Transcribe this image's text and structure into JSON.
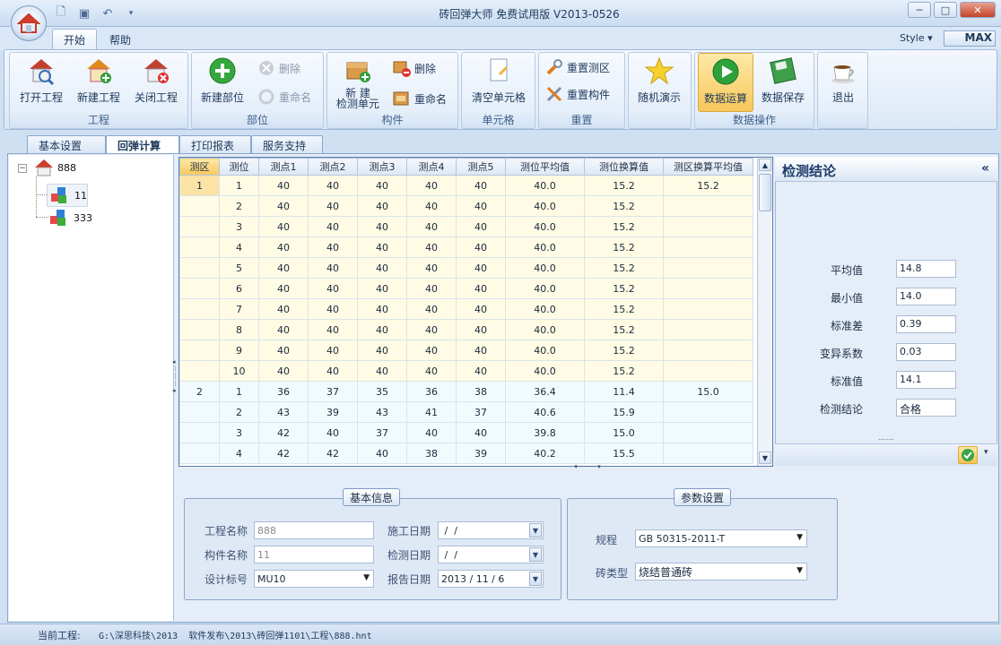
{
  "title": "砖回弹大师 免费试用版 V2013-0526",
  "ribbon_tabs": [
    "开始",
    "帮助"
  ],
  "style_label": "Style",
  "logo_text": "MAX",
  "groups": {
    "project": {
      "label": "工程",
      "open": "打开工程",
      "new": "新建工程",
      "close": "关闭工程"
    },
    "part": {
      "label": "部位",
      "new": "新建部位",
      "delete": "删除",
      "rename": "重命名"
    },
    "component": {
      "label": "构件",
      "new_line1": "新 建",
      "new_line2": "检测单元",
      "delete": "删除",
      "rename": "重命名"
    },
    "cell": {
      "label": "单元格",
      "clear": "清空单元格"
    },
    "reset": {
      "label": "重置",
      "zone": "重置测区",
      "comp": "重置构件"
    },
    "demo": {
      "random": "随机演示"
    },
    "dataops": {
      "label": "数据操作",
      "compute": "数据运算",
      "save": "数据保存"
    },
    "exit": "退出"
  },
  "doc_tabs": [
    "基本设置",
    "回弹计算",
    "打印报表",
    "服务支持"
  ],
  "tree": {
    "root": "888",
    "children": [
      "11",
      "333"
    ]
  },
  "grid": {
    "headers": [
      "测区",
      "测位",
      "测点1",
      "测点2",
      "测点3",
      "测点4",
      "测点5",
      "测位平均值",
      "测位换算值",
      "测区换算平均值"
    ],
    "rows": [
      [
        "1",
        "1",
        "40",
        "40",
        "40",
        "40",
        "40",
        "40.0",
        "15.2",
        "15.2"
      ],
      [
        "",
        "2",
        "40",
        "40",
        "40",
        "40",
        "40",
        "40.0",
        "15.2",
        ""
      ],
      [
        "",
        "3",
        "40",
        "40",
        "40",
        "40",
        "40",
        "40.0",
        "15.2",
        ""
      ],
      [
        "",
        "4",
        "40",
        "40",
        "40",
        "40",
        "40",
        "40.0",
        "15.2",
        ""
      ],
      [
        "",
        "5",
        "40",
        "40",
        "40",
        "40",
        "40",
        "40.0",
        "15.2",
        ""
      ],
      [
        "",
        "6",
        "40",
        "40",
        "40",
        "40",
        "40",
        "40.0",
        "15.2",
        ""
      ],
      [
        "",
        "7",
        "40",
        "40",
        "40",
        "40",
        "40",
        "40.0",
        "15.2",
        ""
      ],
      [
        "",
        "8",
        "40",
        "40",
        "40",
        "40",
        "40",
        "40.0",
        "15.2",
        ""
      ],
      [
        "",
        "9",
        "40",
        "40",
        "40",
        "40",
        "40",
        "40.0",
        "15.2",
        ""
      ],
      [
        "",
        "10",
        "40",
        "40",
        "40",
        "40",
        "40",
        "40.0",
        "15.2",
        ""
      ],
      [
        "2",
        "1",
        "36",
        "37",
        "35",
        "36",
        "38",
        "36.4",
        "11.4",
        "15.0"
      ],
      [
        "",
        "2",
        "43",
        "39",
        "43",
        "41",
        "37",
        "40.6",
        "15.9",
        ""
      ],
      [
        "",
        "3",
        "42",
        "40",
        "37",
        "40",
        "40",
        "39.8",
        "15.0",
        ""
      ],
      [
        "",
        "4",
        "42",
        "42",
        "40",
        "38",
        "39",
        "40.2",
        "15.5",
        ""
      ]
    ]
  },
  "conclusion": {
    "title": "检测结论",
    "collapse": "«",
    "fields": [
      {
        "label": "平均值",
        "value": "14.8"
      },
      {
        "label": "最小值",
        "value": "14.0"
      },
      {
        "label": "标准差",
        "value": "0.39"
      },
      {
        "label": "变异系数",
        "value": "0.03"
      },
      {
        "label": "标准值",
        "value": "14.1"
      },
      {
        "label": "检测结论",
        "value": "合格"
      }
    ]
  },
  "basic_info": {
    "legend": "基本信息",
    "project_name_label": "工程名称",
    "project_name": "888",
    "component_name_label": "构件名称",
    "component_name": "11",
    "design_grade_label": "设计标号",
    "design_grade": "MU10",
    "construction_date_label": "施工日期",
    "construction_date": " /  /",
    "inspection_date_label": "检测日期",
    "inspection_date": " /  /",
    "report_date_label": "报告日期",
    "report_date": "2013 / 11 / 6"
  },
  "params": {
    "legend": "参数设置",
    "spec_label": "规程",
    "spec": "GB 50315-2011-T",
    "brick_label": "砖类型",
    "brick": "烧结普通砖"
  },
  "status": {
    "label": "当前工程:",
    "path": "G:\\深思科技\\2013  软件发布\\2013\\砖回弹1101\\工程\\888.hnt"
  }
}
